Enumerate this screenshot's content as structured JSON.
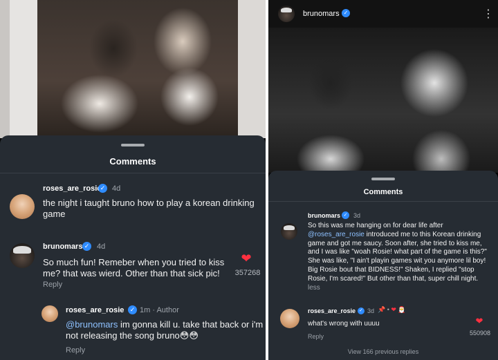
{
  "left": {
    "sheet_title": "Comments",
    "comments": [
      {
        "username": "roses_are_rosie",
        "time": "4d",
        "text": "the night i taught bruno how to play a korean drinking game"
      },
      {
        "username": "brunomars",
        "time": "4d",
        "text": "So much fun! Remeber when you tried to kiss me? that was wierd. Other than that sick pic!",
        "reply_label": "Reply",
        "likes": "357268"
      }
    ],
    "reply": {
      "username": "roses_are_rosie",
      "time": "1m · Author",
      "mention": "@brunomars",
      "text": " im gonna kill u. take that back or i'm not releasing the song bruno😳😳",
      "reply_label": "Reply"
    }
  },
  "right": {
    "header_username": "brunomars",
    "sheet_title": "Comments",
    "comments": [
      {
        "username": "brunomars",
        "time": "3d",
        "text_before": "So this was me hanging on for dear life after ",
        "mention": "@roses_are_rosie",
        "text_after": " introduced me to this Korean drinking game and got me saucy. Soon after, she tried to kiss me, and I was like \"woah Rosie! what part of the game is this?\" She was like, \"I ain't playin games wit you anymore lil boy! Big Rosie bout that BIDNESS!\" Shaken, I replied \"stop Rosie, I'm scared!\" But other than that, super chill night.",
        "more_label": " less"
      },
      {
        "username": "roses_are_rosie",
        "time": "3d",
        "icons_text": "📌 • ",
        "text": "what's wrong with uuuu",
        "reply_label": "Reply",
        "likes": "550908"
      }
    ],
    "view_previous": "View 166 previous replies"
  },
  "icons": [
    "verified-badge",
    "heart-icon",
    "more-options-icon",
    "pin-icon"
  ],
  "colors": {
    "sheet": "#262c33",
    "verified": "#2f8cff",
    "heart": "#ff3040",
    "mention": "#8ec1ff"
  }
}
